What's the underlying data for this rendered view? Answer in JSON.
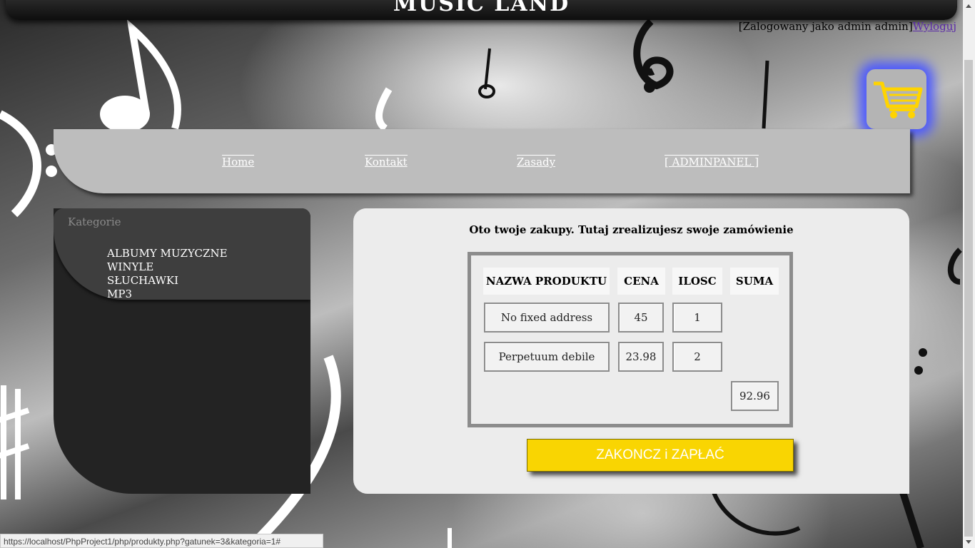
{
  "banner": {
    "title": "MUSIC LAND"
  },
  "header": {
    "login_text": "[Zalogowany jako admin admin]",
    "logout_label": "Wyloguj"
  },
  "nav": {
    "items": [
      {
        "label": "Home"
      },
      {
        "label": "Kontakt"
      },
      {
        "label": "Zasady"
      },
      {
        "label": "[ ADMINPANEL ]"
      }
    ]
  },
  "sidebar": {
    "title": "Kategorie",
    "categories": [
      "ALBUMY MUZYCZNE",
      "WINYLE",
      "SŁUCHAWKI",
      "MP3"
    ]
  },
  "main": {
    "heading": "Oto twoje zakupy. Tutaj zrealizujesz swoje zamówienie",
    "columns": [
      "NAZWA PRODUKTU",
      "CENA",
      "ILOSC",
      "SUMA"
    ],
    "rows": [
      {
        "name": "No fixed address",
        "price": "45",
        "qty": "1"
      },
      {
        "name": "Perpetuum debile",
        "price": "23.98",
        "qty": "2"
      }
    ],
    "total": "92.96",
    "pay_label": "ZAKONCZ i ZAPŁAĆ"
  },
  "status_bar": {
    "url": "https://localhost/PhpProject1/php/produkty.php?gatunek=3&kategoria=1#"
  },
  "icons": {
    "cart": "cart-icon"
  },
  "colors": {
    "accent": "#f9d502",
    "cart_glow": "#4b58ff",
    "nav_bg": "#bdbdbd",
    "panel_bg": "#ececec"
  }
}
